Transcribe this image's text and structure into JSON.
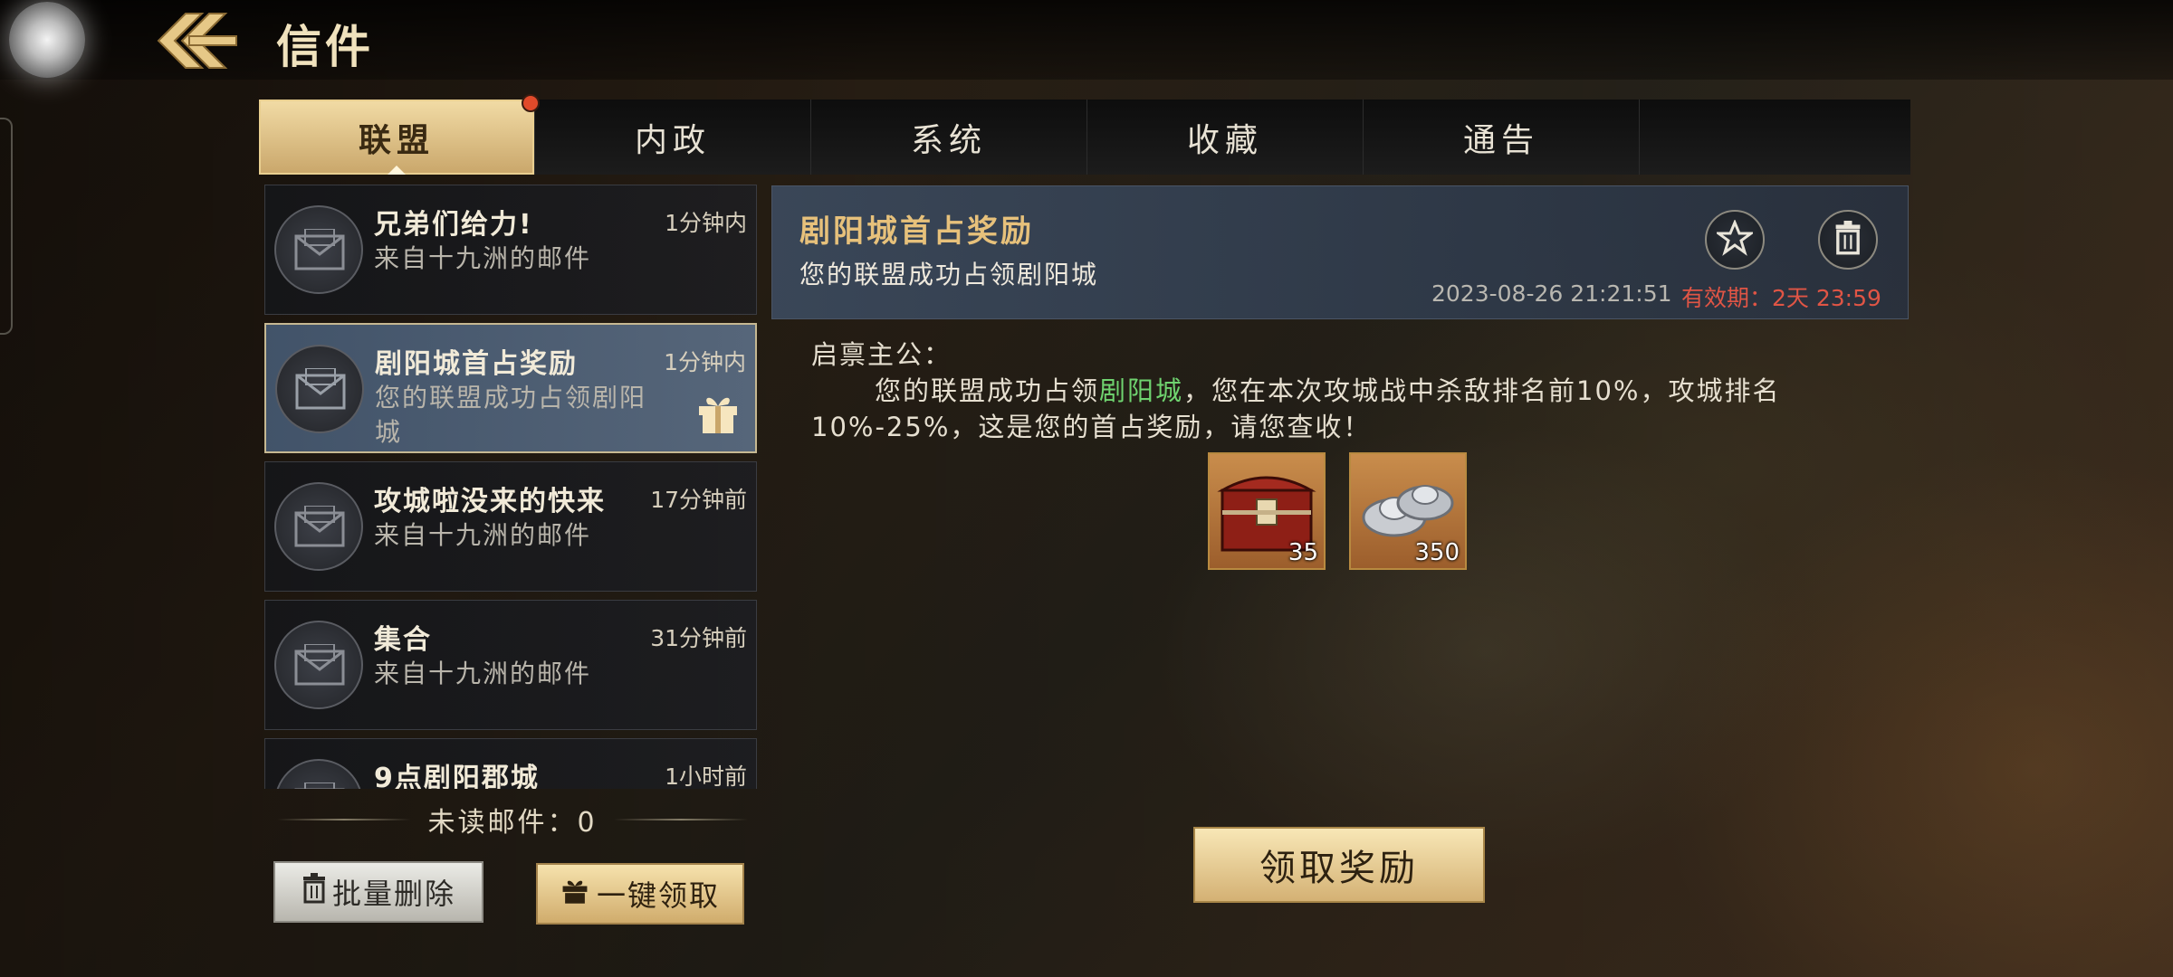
{
  "header": {
    "title": "信件"
  },
  "tabs": [
    {
      "label": "联盟"
    },
    {
      "label": "内政"
    },
    {
      "label": "系统"
    },
    {
      "label": "收藏"
    },
    {
      "label": "通告"
    }
  ],
  "mails": [
    {
      "title": "兄弟们给力!",
      "time": "1分钟内",
      "subtitle": "来自十九洲的邮件"
    },
    {
      "title": "剧阳城首占奖励",
      "time": "1分钟内",
      "subtitle": "您的联盟成功占领剧阳城"
    },
    {
      "title": "攻城啦没来的快来",
      "time": "17分钟前",
      "subtitle": "来自十九洲的邮件"
    },
    {
      "title": "集合",
      "time": "31分钟前",
      "subtitle": "来自十九洲的邮件"
    },
    {
      "title": "9点剧阳郡城",
      "time": "1小时前",
      "subtitle": ""
    }
  ],
  "unread": {
    "text": "未读邮件：0"
  },
  "buttons": {
    "batch_delete": "批量删除",
    "claim_all": "一键领取",
    "claim_reward": "领取奖励"
  },
  "detail": {
    "title": "剧阳城首占奖励",
    "subtitle": "您的联盟成功占领剧阳城",
    "date": "2023-08-26  21:21:51",
    "expiry": "有效期：2天  23:59",
    "greeting": "启禀主公：",
    "body_prefix": "您的联盟成功占领",
    "body_highlight": "剧阳城",
    "body_suffix": "，您在本次攻城战中杀敌排名前10%，攻城排名10%-25%，这是您的首占奖励，请您查收！",
    "rewards": [
      {
        "icon": "treasure-chest-icon",
        "count": "35"
      },
      {
        "icon": "silver-ingot-icon",
        "count": "350"
      }
    ]
  },
  "colors": {
    "gold": "#e7c17b",
    "highlight_green": "#6fd36f",
    "expiry_red": "#e05545"
  }
}
